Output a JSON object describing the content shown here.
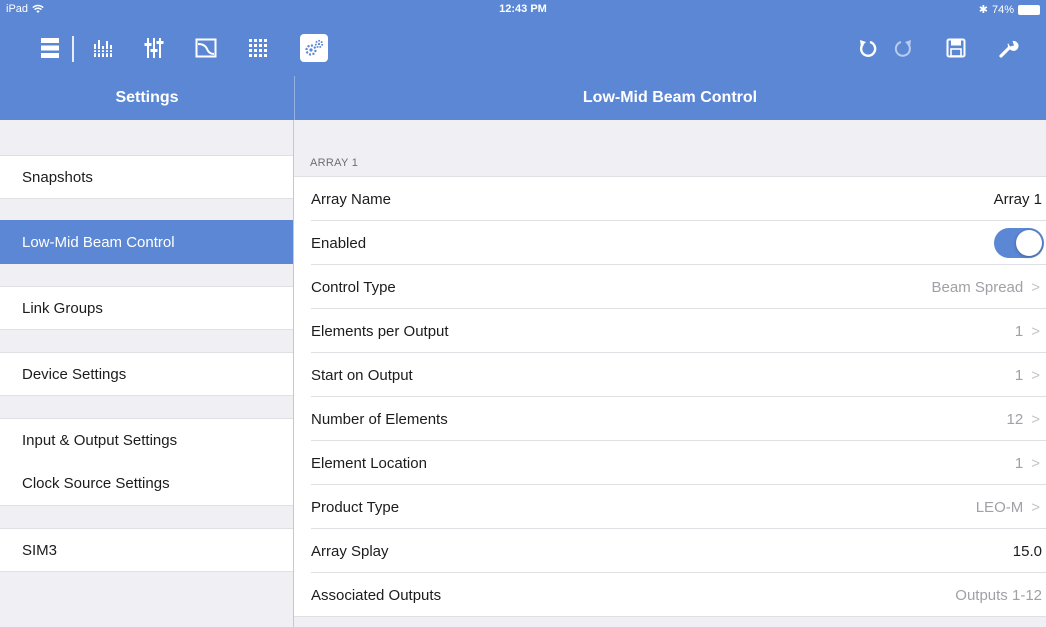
{
  "status": {
    "device": "iPad",
    "time": "12:43 PM",
    "battery": "74%"
  },
  "toolbar": {
    "icons": [
      "device-list-icon",
      "meter-bank-icon",
      "faders-icon",
      "eq-curve-icon",
      "matrix-grid-icon",
      "beam-control-icon",
      "undo-icon",
      "redo-icon",
      "save-icon",
      "wrench-icon"
    ],
    "selected": "beam-control-icon",
    "accent": "#5b87d4"
  },
  "sidebar": {
    "title": "Settings",
    "items": [
      {
        "label": "Snapshots"
      },
      {
        "label": "Low-Mid Beam Control",
        "active": true
      },
      {
        "label": "Link Groups"
      },
      {
        "label": "Device Settings"
      },
      {
        "label": "Input & Output Settings"
      },
      {
        "label": "Clock Source Settings"
      },
      {
        "label": "SIM3"
      }
    ]
  },
  "main": {
    "title": "Low-Mid Beam Control",
    "section": "ARRAY 1",
    "rows": [
      {
        "label": "Array Name",
        "value": "Array 1"
      },
      {
        "label": "Enabled",
        "value": "on"
      },
      {
        "label": "Control Type",
        "value": "Beam Spread"
      },
      {
        "label": "Elements per Output",
        "value": "1"
      },
      {
        "label": "Start on Output",
        "value": "1"
      },
      {
        "label": "Number of Elements",
        "value": "12"
      },
      {
        "label": "Element Location",
        "value": "1"
      },
      {
        "label": "Product Type",
        "value": "LEO-M"
      },
      {
        "label": "Array Splay",
        "value": "15.0"
      },
      {
        "label": "Associated Outputs",
        "value": "Outputs 1-12"
      }
    ]
  }
}
